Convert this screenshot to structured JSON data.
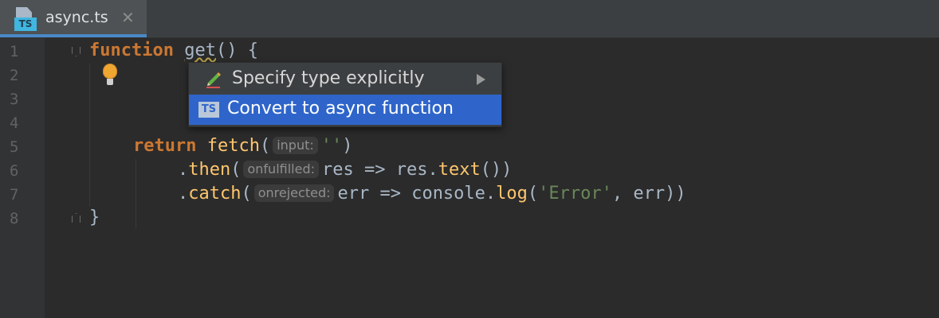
{
  "tab": {
    "title": "async.ts",
    "icon": "typescript-file-icon",
    "badge": "TS",
    "close": "✕"
  },
  "editor": {
    "line_numbers": [
      "1",
      "2",
      "3",
      "4",
      "5",
      "6",
      "7",
      "8"
    ],
    "line1": {
      "kw": "function",
      "name": "get",
      "rest": "() {"
    },
    "line5": {
      "kw": "return",
      "call": "fetch",
      "open": "(",
      "hint": "input:",
      "str": "''",
      "close": ")"
    },
    "line6": {
      "dot": ".",
      "method": "then",
      "open": "(",
      "hint": "onfulfilled:",
      "a": "res => res.",
      "method2": "text",
      "rest": "())"
    },
    "line7": {
      "dot": ".",
      "method": "catch",
      "open": "(",
      "hint": "onrejected:",
      "a": "err => console.",
      "method2": "log",
      "open2": "(",
      "str": "'Error'",
      "rest": ", err))"
    },
    "line8": {
      "text": "}"
    }
  },
  "intentions": {
    "bulb_icon": "lightbulb-icon",
    "items": [
      {
        "label": "Specify type explicitly",
        "icon": "pencil-icon",
        "has_submenu": true
      },
      {
        "label": "Convert to async function",
        "icon": "typescript-icon",
        "badge": "TS",
        "selected": true
      }
    ]
  },
  "colors": {
    "background": "#2b2b2b",
    "keyword": "#cc7832",
    "function": "#ffc66d",
    "string": "#6a8759",
    "selection": "#2f65ca",
    "tab_accent": "#4a88c7"
  }
}
